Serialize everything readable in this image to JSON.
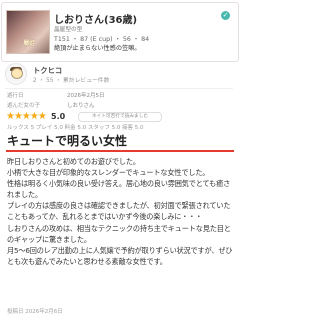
{
  "profile": {
    "name": "しおりさん(36歳)",
    "shop": "晶屋型の型",
    "stats": "T151 ・ 87 (E cup) ・ 56 ・ 84",
    "catch": "絶頂が止まらない性感の笠嘛。",
    "photo_caption": "麗姫"
  },
  "reviewer": {
    "name": "トクヒコ",
    "meta": "2 ・ 55 ・ 累計レビュー件数"
  },
  "details": {
    "date_label": "遊行日",
    "date_value": "2026年2月5日",
    "lady_label": "遊んだ女の子",
    "lady_value": "しおりさん"
  },
  "rating": {
    "stars": "★★★★★",
    "score": "5.0",
    "useful_label": "ネイト可否行で読みました",
    "subscores": "ルックス 5 プレイ 5.0 料金 5.0 スタッフ 5.0 接客 5.0"
  },
  "review": {
    "title": "キュートで明るい女性",
    "paragraphs": [
      "昨日しおりさんと初めてのお遊びでした。",
      "小柄で大きな目が印象的なスレンダーでキュートな女性でした。",
      "性格は明るく小気味の良い受け答え。居心地の良い雰囲気でとても癒されました。",
      "プレイの方は感度の良さは確認できましたが、初対面で緊張されていたこともあってか、乱れるとまではいかず今後の楽しみに・・・",
      "しおりさんの攻めは、相当なテクニックの持ち主でキュートな見た目とのギャップに驚きました。",
      "月5～6回のレア出勤の上に人気嬢で予約が取りずらい状況ですが、ぜひとも次も遊んでみたいと思わせる素敵な女性です。"
    ],
    "posted": "投稿日 2026年2月6日"
  }
}
